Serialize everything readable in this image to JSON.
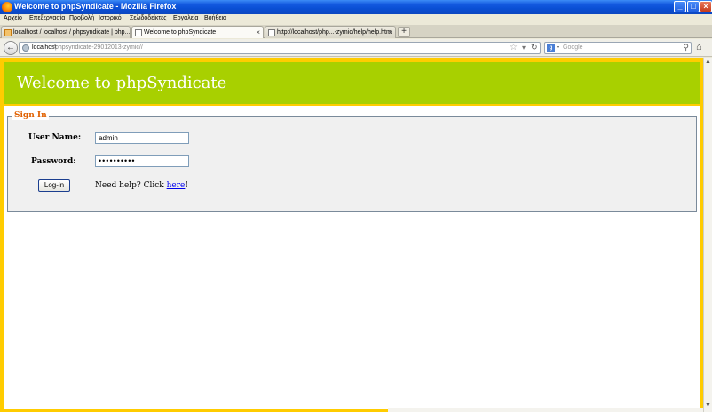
{
  "window": {
    "title": "Welcome to phpSyndicate - Mozilla Firefox",
    "controls": {
      "minimize": "_",
      "maximize": "□",
      "close": "×"
    }
  },
  "menu": [
    "Αρχείο",
    "Επεξεργασία",
    "Προβολή",
    "Ιστορικό",
    "Σελιδοδείκτες",
    "Εργαλεία",
    "Βοήθεια"
  ],
  "tabs": [
    {
      "label": "localhost / localhost / phpsyndicate | php...",
      "active": false,
      "favicon": "phpmyadmin-icon"
    },
    {
      "label": "Welcome to phpSyndicate",
      "active": true,
      "favicon": "page-icon"
    },
    {
      "label": "http://localhost/php...-zymic/help/help.htm",
      "active": false,
      "favicon": "page-icon"
    }
  ],
  "navbar": {
    "url_host": "localhost",
    "url_path": "/phpsyndicate-29012013-zymic//",
    "search_placeholder": "Google"
  },
  "page": {
    "header_title": "Welcome to phpSyndicate",
    "header_color": "#a8d000",
    "border_color": "#ffcc00",
    "legend": "Sign In",
    "legend_color": "#e06000",
    "username_label": "User Name:",
    "username_value": "admin",
    "password_label": "Password:",
    "password_value": "••••••••••",
    "login_button": "Log-in",
    "help_text": "Need help? Click ",
    "help_link": "here",
    "help_suffix": "!"
  }
}
